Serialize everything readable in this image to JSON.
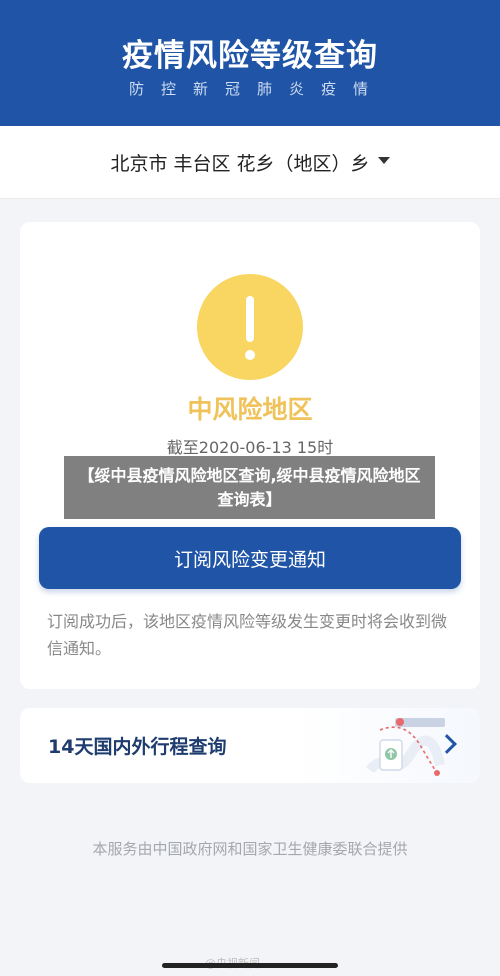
{
  "header": {
    "title": "疫情风险等级查询",
    "subtitle": "防控新冠肺炎疫情"
  },
  "location": {
    "text": "北京市 丰台区 花乡（地区）乡"
  },
  "risk": {
    "level": "中风险地区",
    "cutoff": "截至2020-06-13 15时",
    "icon_color": "#f8d661"
  },
  "subscribe": {
    "button_label": "订阅风险变更通知",
    "note": "订阅成功后，该地区疫情风险等级发生变更时将会收到微信通知。"
  },
  "trip": {
    "label": "14天国内外行程查询"
  },
  "footer": {
    "text": "本服务由中国政府网和国家卫生健康委联合提供"
  },
  "watermark": "@央视新闻",
  "overlay": {
    "text": "【绥中县疫情风险地区查询,绥中县疫情风险地区查询表】"
  },
  "colors": {
    "brand": "#1f54a6",
    "warning": "#f8d661",
    "warning_text": "#efc25a"
  }
}
